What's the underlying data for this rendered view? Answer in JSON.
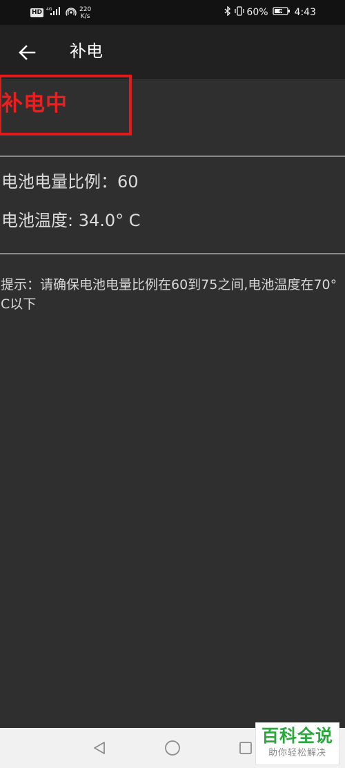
{
  "status_bar": {
    "hd": "HD",
    "network_type": "4G",
    "speed_value": "220",
    "speed_unit": "K/s",
    "battery_percent": "60%",
    "time": "4:43"
  },
  "app_bar": {
    "title": "补电"
  },
  "status": {
    "charging_text": "补电中"
  },
  "battery_info": {
    "level_label": "电池电量比例：",
    "level_value": "60",
    "temp_label": "电池温度:",
    "temp_value": "34.0° C"
  },
  "hint": {
    "text": "提示：请确保电池电量比例在60到75之间,电池温度在70° C以下"
  },
  "watermark": {
    "title": "百科全说",
    "subtitle": "助你轻松解决"
  },
  "colors": {
    "background": "#2f2f2f",
    "app_bar": "#212121",
    "status_bar": "#121212",
    "accent_red": "#ee1e1e",
    "divider": "#8a8a8a",
    "watermark_green": "#2aa73d"
  },
  "icons": {
    "back": "arrow-left-icon",
    "signal": "signal-icon",
    "hotspot": "hotspot-icon",
    "bluetooth": "bluetooth-icon",
    "vibrate": "vibrate-icon",
    "battery": "battery-charging-icon",
    "nav_back": "triangle-back-icon",
    "nav_home": "circle-home-icon",
    "nav_recents": "square-recents-icon"
  }
}
